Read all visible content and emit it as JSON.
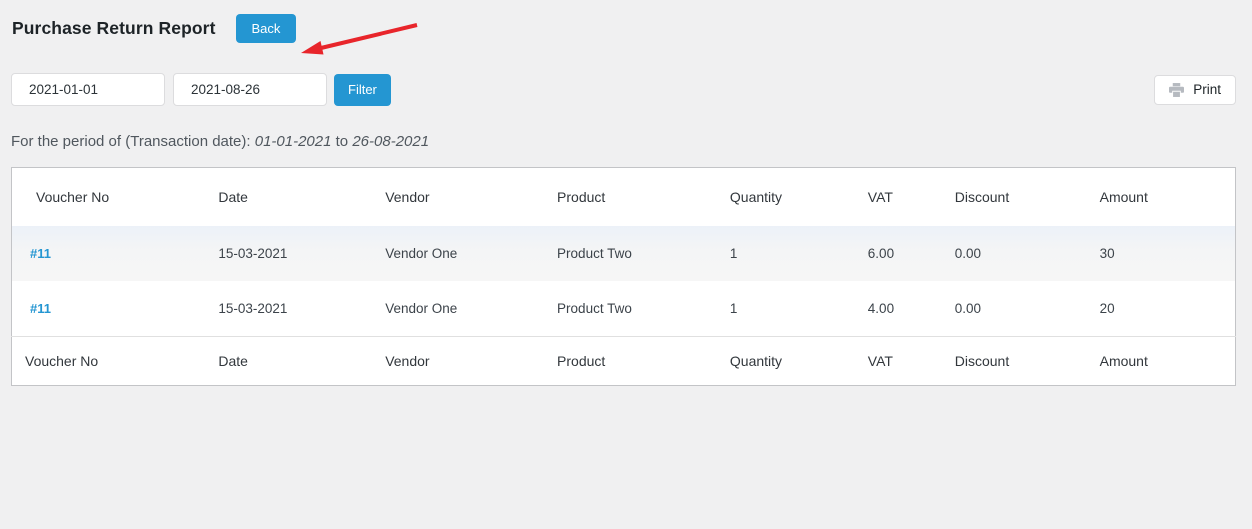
{
  "header": {
    "title": "Purchase Return Report",
    "back_button": "Back"
  },
  "filter_bar": {
    "start_date_value": "2021-01-01",
    "end_date_value": "2021-08-26",
    "filter_button": "Filter",
    "print_button": "Print",
    "print_icon": "printer-icon"
  },
  "period_line": {
    "label": "For the period of (Transaction date):",
    "start_date": "01-01-2021",
    "connector": "to",
    "end_date": "26-08-2021"
  },
  "report_table": {
    "columns": [
      "Voucher No",
      "Date",
      "Vendor",
      "Product",
      "Quantity",
      "VAT",
      "Discount",
      "Amount"
    ],
    "rows": [
      {
        "voucher_no": "#11",
        "date": "15-03-2021",
        "vendor": "Vendor One",
        "product": "Product Two",
        "quantity": "1",
        "vat": "6.00",
        "discount": "0.00",
        "amount": "30"
      },
      {
        "voucher_no": "#11",
        "date": "15-03-2021",
        "vendor": "Vendor One",
        "product": "Product Two",
        "quantity": "1",
        "vat": "4.00",
        "discount": "0.00",
        "amount": "20"
      }
    ],
    "footer_columns": [
      "Voucher No",
      "Date",
      "Vendor",
      "Product",
      "Quantity",
      "VAT",
      "Discount",
      "Amount"
    ]
  },
  "annotation": {
    "arrow": "red-arrow-pointing-to-date-filter"
  },
  "colors": {
    "accent_blue": "#2496d2",
    "page_background": "#f0f0f1",
    "table_border": "#c3c4c7",
    "arrow_red": "#e8252b"
  }
}
